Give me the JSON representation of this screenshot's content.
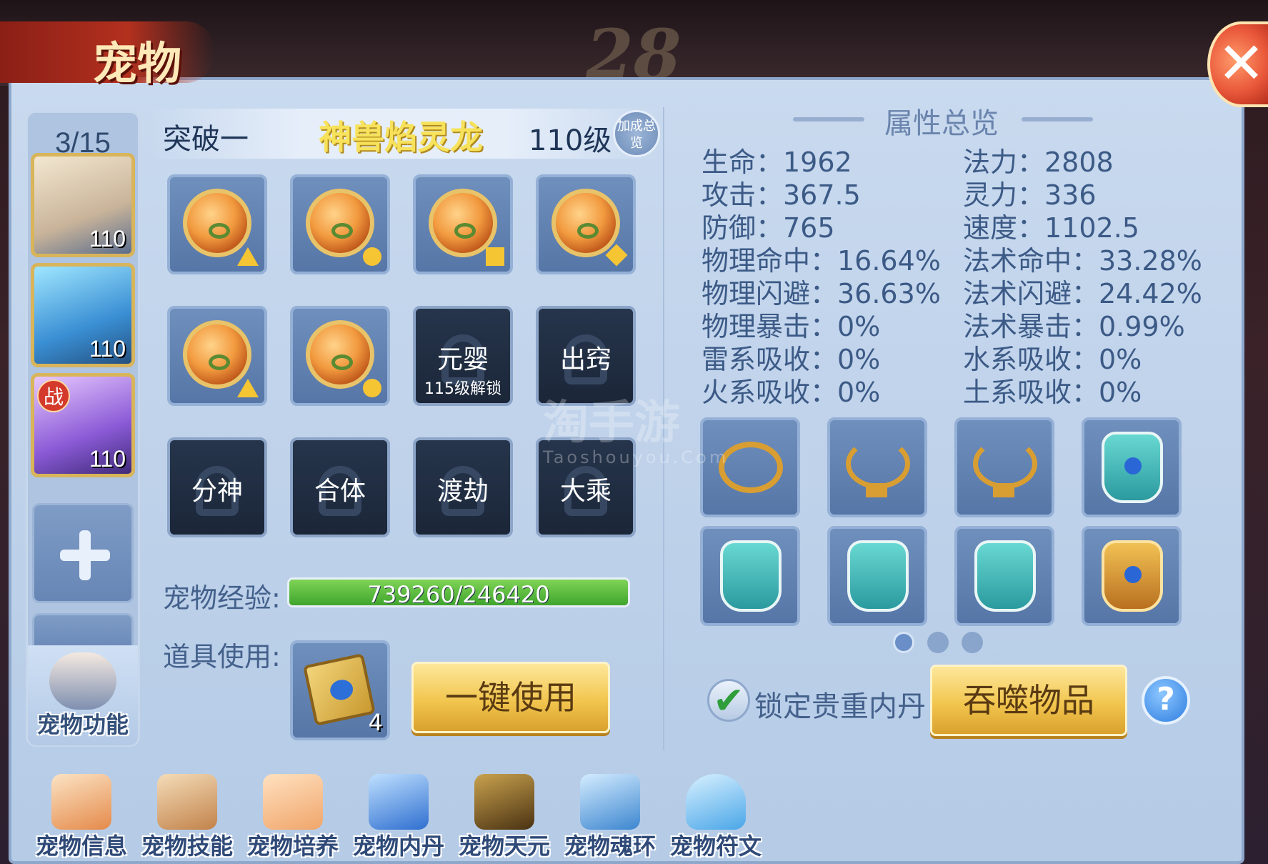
{
  "window": {
    "title": "宠物",
    "timer": "28",
    "close_icon": "close-icon"
  },
  "sidebar": {
    "count": "3/15",
    "pets": [
      {
        "level": "110",
        "icon": "white-dragon-avatar",
        "battle": ""
      },
      {
        "level": "110",
        "icon": "blue-dragon-avatar",
        "battle": ""
      },
      {
        "level": "110",
        "icon": "purple-dragon-avatar",
        "battle": "战"
      }
    ],
    "func_label": "宠物功能"
  },
  "header": {
    "break_label": "突破一",
    "pet_name": "神兽焰灵龙",
    "level": "110级",
    "bonus": "加成总览"
  },
  "neidan": {
    "row1": [
      {
        "mark": "tri"
      },
      {
        "mark": "circle"
      },
      {
        "mark": "square"
      },
      {
        "mark": "diamond"
      }
    ],
    "row2_orbs": [
      {
        "mark": "tri"
      },
      {
        "mark": "circle"
      }
    ],
    "locked": [
      {
        "label": "元婴",
        "sub": "115级解锁"
      },
      {
        "label": "出窍",
        "sub": ""
      },
      {
        "label": "分神",
        "sub": ""
      },
      {
        "label": "合体",
        "sub": ""
      },
      {
        "label": "渡劫",
        "sub": ""
      },
      {
        "label": "大乘",
        "sub": ""
      }
    ]
  },
  "exp": {
    "label": "宠物经验:",
    "text": "739260/246420",
    "fill_fraction": 1.0
  },
  "item": {
    "label": "道具使用:",
    "count": "4",
    "use_button": "一键使用"
  },
  "attributes": {
    "title": "属性总览",
    "left": [
      "生命：1962",
      "攻击：367.5",
      "防御：765",
      "物理命中：16.64%",
      "物理闪避：36.63%",
      "物理暴击：0%",
      "雷系吸收：0%",
      "火系吸收：0%"
    ],
    "right": [
      "法力：2808",
      "灵力：336",
      "速度：1102.5",
      "法术命中：33.28%",
      "法术闪避：24.42%",
      "法术暴击：0.99%",
      "水系吸收：0%",
      "土系吸收：0%"
    ]
  },
  "equipment": [
    "ring-icon",
    "necklace-icon",
    "necklace-icon",
    "armor-icon",
    "armor-icon",
    "armor-icon",
    "armor-icon",
    "gold-armor-icon"
  ],
  "pagination": {
    "pages": 3,
    "active": 1
  },
  "lock": {
    "label": "锁定贵重内丹",
    "checked": true
  },
  "devour_button": "吞噬物品",
  "help": "?",
  "bottom_nav": [
    {
      "label": "宠物信息",
      "color": "#e58a4a"
    },
    {
      "label": "宠物技能",
      "color": "#d39a5e"
    },
    {
      "label": "宠物培养",
      "color": "#f0a56a"
    },
    {
      "label": "宠物内丹",
      "color": "#4e86d6"
    },
    {
      "label": "宠物天元",
      "color": "#6a4a1f"
    },
    {
      "label": "宠物魂环",
      "color": "#5a9ad6"
    },
    {
      "label": "宠物符文",
      "color": "#6ab3e8"
    }
  ],
  "watermark": {
    "main": "淘手游",
    "sub": "Taoshouyou.Com"
  }
}
